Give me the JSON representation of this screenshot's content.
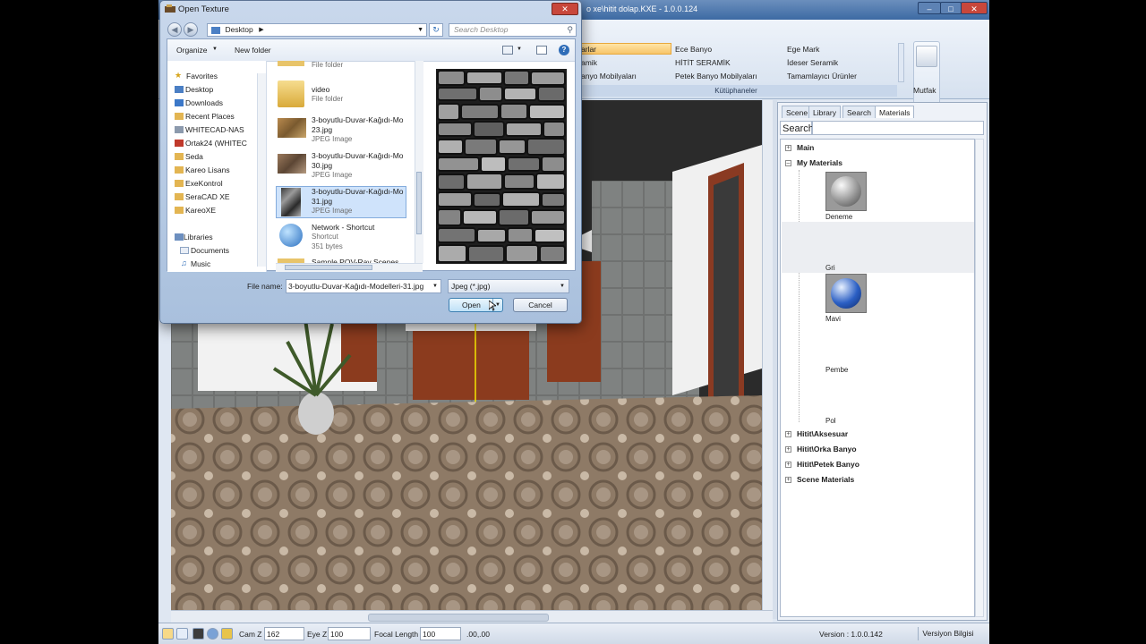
{
  "app": {
    "title": "o xe\\hitit dolap.KXE - 1.0.0.124",
    "ribbon": {
      "libraries": [
        "arlar",
        "Ece Banyo",
        "Ege Mark",
        "amik",
        "HİTİT SERAMİK",
        "İdeser Seramik",
        "anyo Mobilyaları",
        "Petek Banyo Mobilyaları",
        "Tamamlayıcı Ürünler"
      ],
      "group_label": "Kütüphaneler",
      "mutfak_label": "Mutfak"
    },
    "right_panel": {
      "tabs": [
        "Scene",
        "Library",
        "Search",
        "Materials"
      ],
      "active_tab": "Materials",
      "search_label": "Search",
      "tree": {
        "main": "Main",
        "my_materials": "My Materials",
        "materials": [
          "Deneme",
          "Gri",
          "Mavi",
          "Pembe",
          "Pol"
        ],
        "groups": [
          "Hitit\\Aksesuar",
          "Hitit\\Orka Banyo",
          "Hitit\\Petek Banyo",
          "Scene Materials"
        ]
      }
    },
    "statusbar": {
      "cam_z_label": "Cam Z",
      "cam_z_value": "162",
      "eye_z_label": "Eye Z",
      "eye_z_value": "100",
      "focal_label": "Focal Length",
      "focal_value": "100",
      "coords": ".00,.00",
      "version": "Version : 1.0.0.142",
      "version_button": "Versiyon Bilgisi"
    }
  },
  "dialog": {
    "title": "Open Texture",
    "location": "Desktop",
    "search_placeholder": "Search Desktop",
    "organize": "Organize",
    "new_folder": "New folder",
    "nav": {
      "favorites": "Favorites",
      "items": [
        "Desktop",
        "Downloads",
        "Recent Places",
        "WHITECAD-NAS",
        "Ortak24 (WHITEC",
        "Seda",
        "Kareo Lisans",
        "ExeKontrol",
        "SeraCAD XE",
        "KareoXE"
      ],
      "libraries": "Libraries",
      "lib_items": [
        "Documents",
        "Music"
      ]
    },
    "files": [
      {
        "name": "",
        "type": "File folder"
      },
      {
        "name": "video",
        "type": "File folder"
      },
      {
        "name": "3-boyutlu-Duvar-Kağıdı-Mo",
        "name2": "23.jpg",
        "type": "JPEG Image"
      },
      {
        "name": "3-boyutlu-Duvar-Kağıdı-Mo",
        "name2": "30.jpg",
        "type": "JPEG Image"
      },
      {
        "name": "3-boyutlu-Duvar-Kağıdı-Mo",
        "name2": "31.jpg",
        "type": "JPEG Image"
      },
      {
        "name": "Network - Shortcut",
        "name2": "Shortcut",
        "type": "351 bytes"
      },
      {
        "name": "Sample POV-Ray Scenes",
        "name2": "",
        "type": ""
      }
    ],
    "filename_label": "File name:",
    "filename_value": "3-boyutlu-Duvar-Kağıdı-Modelleri-31.jpg",
    "filetype_value": "Jpeg (*.jpg)",
    "open_button": "Open",
    "cancel_button": "Cancel"
  }
}
